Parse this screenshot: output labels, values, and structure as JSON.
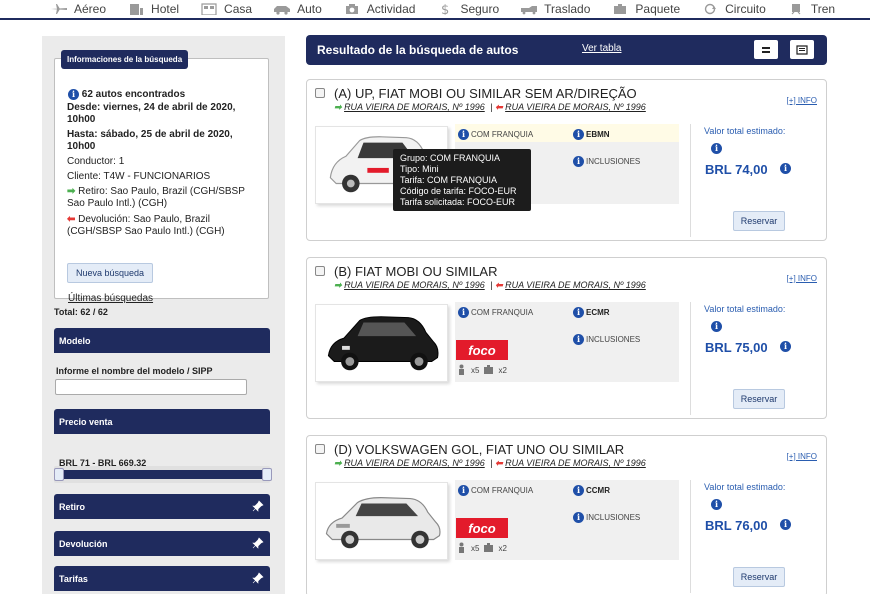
{
  "nav": [
    {
      "label": "Aéreo",
      "icon": "plane-icon"
    },
    {
      "label": "Hotel",
      "icon": "building-icon"
    },
    {
      "label": "Casa",
      "icon": "house-icon"
    },
    {
      "label": "Auto",
      "icon": "car-icon"
    },
    {
      "label": "Actividad",
      "icon": "camera-icon"
    },
    {
      "label": "Seguro",
      "icon": "dollar-icon"
    },
    {
      "label": "Traslado",
      "icon": "transfer-icon"
    },
    {
      "label": "Paquete",
      "icon": "suitcase-icon"
    },
    {
      "label": "Circuito",
      "icon": "circuit-icon"
    },
    {
      "label": "Tren",
      "icon": "train-icon"
    }
  ],
  "search_info": {
    "title": "Informaciones de la búsqueda",
    "found": "62 autos encontrados",
    "desde": "Desde: viernes, 24 de abril de 2020,",
    "desde_time": "10h00",
    "hasta": "Hasta: sábado, 25 de abril de 2020,",
    "hasta_time": "10h00",
    "conductor": "Conductor: 1",
    "cliente": "Cliente: T4W - FUNCIONARIOS",
    "retiro_1": "Retiro: Sao Paulo, Brazil (CGH/SBSP",
    "retiro_2": "Sao Paulo Intl.) (CGH)",
    "devolucion_1": "Devolución: Sao Paulo, Brazil",
    "devolucion_2": "(CGH/SBSP Sao Paulo Intl.) (CGH)",
    "nueva_busqueda": "Nueva búsqueda",
    "ultimas": "Últimas búsquedas"
  },
  "total": "Total: 62 / 62",
  "filters": {
    "modelo": "Modelo",
    "modelo_label": "Informe el nombre del modelo / SIPP",
    "precio": "Precio venta",
    "range": "BRL 71 - BRL 669.32",
    "retiro": "Retiro",
    "devolucion": "Devolución",
    "tarifas": "Tarifas"
  },
  "results": {
    "title": "Resultado de la búsqueda de autos",
    "ver_tabla": "Ver tabla"
  },
  "cars": [
    {
      "title": "(A) UP, FIAT MOBI OU SIMILAR SEM AR/DIREÇÃO",
      "loc1": "RUA VIEIRA DE MORAIS, Nº 1996",
      "loc2": "RUA VIEIRA DE MORAIS, Nº 1996",
      "info": "[+] INFO",
      "franquia": "COM FRANQUIA",
      "sipp": "EBMN",
      "inclusiones": "INCLUSIONES",
      "price_label": "Valor total estimado:",
      "price": "BRL 74,00",
      "reservar": "Reservar"
    },
    {
      "title": "(B) FIAT MOBI OU SIMILAR",
      "loc1": "RUA VIEIRA DE MORAIS, Nº 1996",
      "loc2": "RUA VIEIRA DE MORAIS, Nº 1996",
      "info": "[+] INFO",
      "franquia": "COM FRANQUIA",
      "sipp": "ECMR",
      "inclusiones": "INCLUSIONES",
      "brand": "foco",
      "pax": "x5",
      "bags": "x2",
      "price_label": "Valor total estimado:",
      "price": "BRL 75,00",
      "reservar": "Reservar"
    },
    {
      "title": "(D) VOLKSWAGEN GOL, FIAT UNO OU SIMILAR",
      "loc1": "RUA VIEIRA DE MORAIS, Nº 1996",
      "loc2": "RUA VIEIRA DE MORAIS, Nº 1996",
      "info": "[+] INFO",
      "franquia": "COM FRANQUIA",
      "sipp": "CCMR",
      "inclusiones": "INCLUSIONES",
      "brand": "foco",
      "pax": "x5",
      "bags": "x2",
      "price_label": "Valor total estimado:",
      "price": "BRL 76,00",
      "reservar": "Reservar"
    }
  ],
  "tooltip": {
    "grupo": "Grupo: COM FRANQUIA",
    "tipo": "Tipo: Mini",
    "tarifa": "Tarifa: COM FRANQUIA",
    "codigo": "Código de tarifa: FOCO-EUR",
    "solicitada": "Tarifa solicitada: FOCO-EUR"
  },
  "colors": {
    "navy": "#1f2b5e",
    "link": "#2a5db0",
    "price": "#1f4fa8",
    "brand_red": "#e31b2b"
  }
}
